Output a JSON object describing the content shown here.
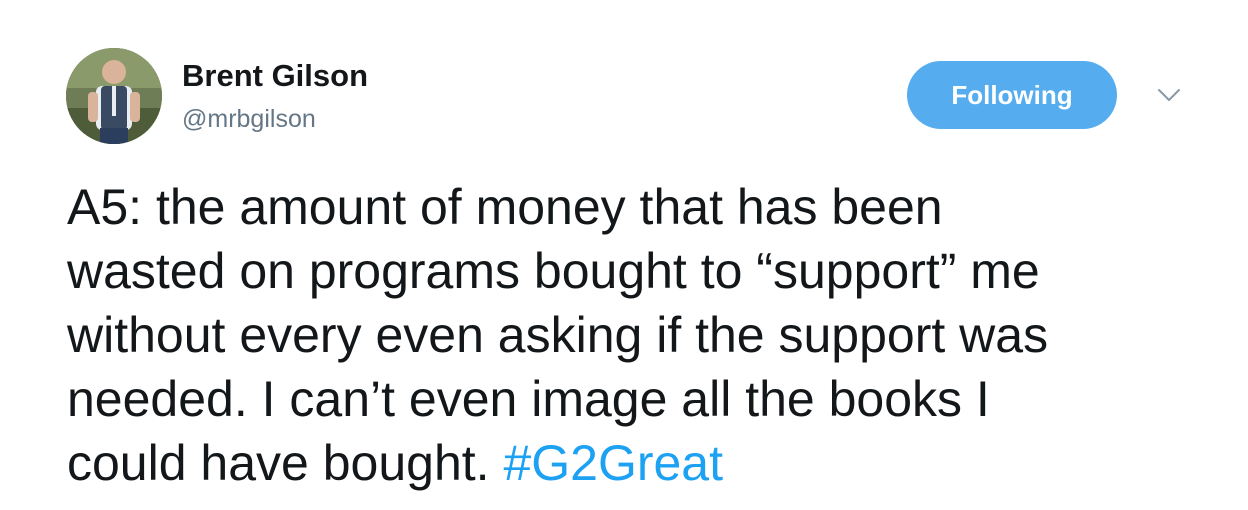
{
  "author": {
    "display_name": "Brent Gilson",
    "handle": "@mrbgilson",
    "avatar_icon": "profile-photo-avatar"
  },
  "actions": {
    "follow_label": "Following",
    "follow_color": "#55acee",
    "menu_icon": "chevron-down-icon"
  },
  "tweet": {
    "lines": [
      "A5: the amount of money that has been",
      "wasted on programs bought to “support” me",
      "without every even asking if the support was",
      "needed. I can’t even image all the books I",
      "could have bought. "
    ],
    "hashtag": "#G2Great",
    "hashtag_color": "#1da1f2"
  }
}
